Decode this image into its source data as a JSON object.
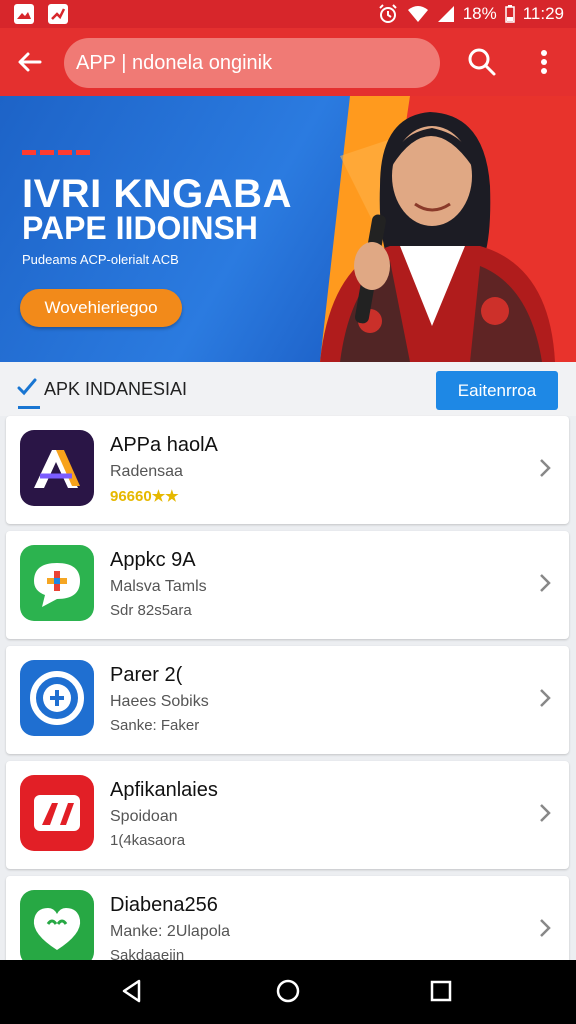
{
  "status_bar": {
    "battery": "18%",
    "time": "11:29"
  },
  "app_bar": {
    "search_value": "APP | ndonela onginik"
  },
  "banner": {
    "headline": "IVRI KNGABA",
    "subheadline": "PAPE IIDOINSH",
    "tagline": "Pudeams ACP-olerialt ACB",
    "cta_label": "Wovehieriegoo"
  },
  "section": {
    "title": "APK INDANESIAI",
    "button_label": "Eaitenrroa"
  },
  "apps": [
    {
      "name": "APPa haolA",
      "subtitle": "Radensaa",
      "meta": "96660",
      "stars": "★★",
      "icon": "apk-logo-icon"
    },
    {
      "name": "Appkc 9A",
      "subtitle": "Malsva Tamls",
      "meta": "Sdr 82s5ara",
      "icon": "chat-plus-icon"
    },
    {
      "name": "Parer 2(",
      "subtitle": "Haees Sobiks",
      "meta": "Sanke: Faker",
      "icon": "circle-logo-icon"
    },
    {
      "name": "Apfikanlaies",
      "subtitle": "Spoidoan",
      "meta": "1(4kasaora",
      "icon": "split-logo-icon"
    },
    {
      "name": "Diabena256",
      "subtitle": "Manke: 2Ulapola",
      "meta": "Sakdaaeiin",
      "icon": "heart-chat-icon"
    }
  ],
  "colors": {
    "primary_red": "#e4302f",
    "accent_blue": "#1e88e5",
    "cta_orange": "#f28a1a"
  }
}
